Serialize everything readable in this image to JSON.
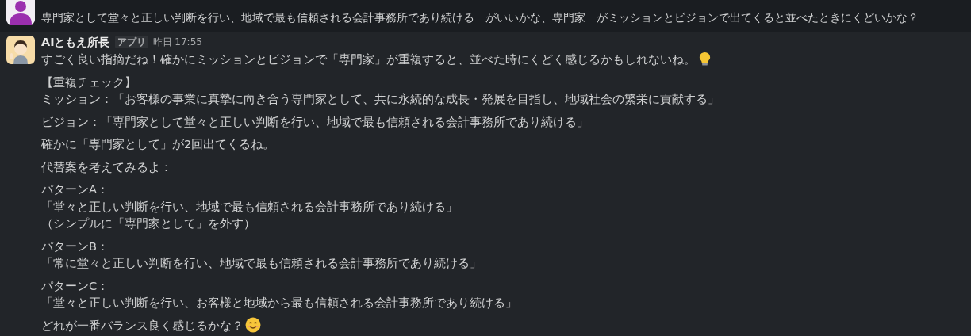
{
  "messages": [
    {
      "kind": "partial",
      "text": "専門家として堂々と正しい判断を行い、地域で最も信頼される会計事務所であり続ける　がいいかな、専門家　がミッションとビジョンで出てくると並べたときにくどいかな？"
    },
    {
      "kind": "full",
      "author": "AIともえ所長",
      "badge": "アプリ",
      "time": "昨日 17:55",
      "paragraphs": [
        {
          "lines": [
            "すごく良い指摘だね！確かにミッションとビジョンで「専門家」が重複すると、並べた時にくどく感じるかもしれないね。"
          ]
        },
        {
          "lines": [
            "【重複チェック】",
            "ミッション：「お客様の事業に真摯に向き合う専門家として、共に永続的な成長・発展を目指し、地域社会の繁栄に貢献する」"
          ]
        },
        {
          "lines": [
            "ビジョン：「専門家として堂々と正しい判断を行い、地域で最も信頼される会計事務所であり続ける」"
          ]
        },
        {
          "lines": [
            "確かに「専門家として」が2回出てくるね。"
          ]
        },
        {
          "lines": [
            "代替案を考えてみるよ："
          ]
        },
        {
          "lines": [
            "パターンA：",
            "「堂々と正しい判断を行い、地域で最も信頼される会計事務所であり続ける」",
            "（シンプルに「専門家として」を外す）"
          ]
        },
        {
          "lines": [
            "パターンB：",
            "「常に堂々と正しい判断を行い、地域で最も信頼される会計事務所であり続ける」"
          ]
        },
        {
          "lines": [
            "パターンC：",
            "「堂々と正しい判断を行い、お客様と地域から最も信頼される会計事務所であり続ける」"
          ]
        },
        {
          "lines": [
            "どれが一番バランス良く感じるかな？"
          ]
        }
      ]
    }
  ]
}
